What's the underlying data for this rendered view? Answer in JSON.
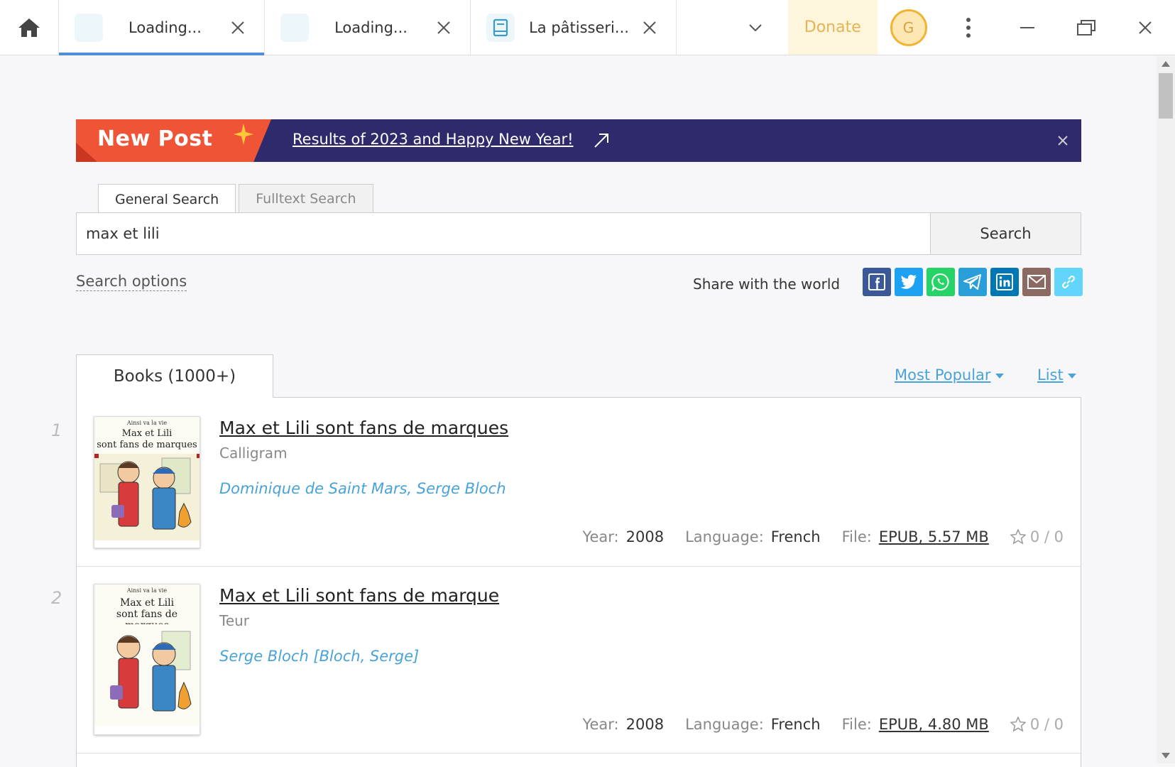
{
  "tabs": [
    {
      "title": "Loading...",
      "active": true
    },
    {
      "title": "Loading...",
      "active": false
    },
    {
      "title": "La pâtisseri...",
      "active": false
    }
  ],
  "toolbar": {
    "donate_label": "Donate",
    "avatar_letter": "G"
  },
  "banner": {
    "badge": "New Post",
    "link_text": "Results of 2023 and Happy New Year!"
  },
  "search": {
    "tabs": [
      "General Search",
      "Fulltext Search"
    ],
    "query": "max et lili",
    "button_label": "Search",
    "options_label": "Search options",
    "share_label": "Share with the world"
  },
  "results": {
    "tab_label": "Books (1000+)",
    "sort_label": "Most Popular",
    "view_label": "List",
    "labels": {
      "year": "Year:",
      "language": "Language:",
      "file": "File:"
    },
    "items": [
      {
        "num": "1",
        "title": "Max et Lili sont fans de marques",
        "publisher": "Calligram",
        "authors": "Dominique de Saint Mars, Serge Bloch",
        "year": "2008",
        "language": "French",
        "file": "EPUB, 5.57 MB",
        "rating": "0 / 0",
        "cover_series": "Ainsi va la vie",
        "cover_title_1": "Max et Lili",
        "cover_title_2": "sont fans de marques"
      },
      {
        "num": "2",
        "title": "Max et Lili sont fans de marque",
        "publisher": "Teur",
        "authors": "Serge Bloch [Bloch, Serge]",
        "year": "2008",
        "language": "French",
        "file": "EPUB, 4.80 MB",
        "rating": "0 / 0",
        "cover_series": "Ainsi va la vie",
        "cover_title_1": "Max et Lili",
        "cover_title_2": "sont fans de marques"
      }
    ]
  },
  "colors": {
    "accent": "#4aa3d8",
    "banner_bg": "#2e2a6c",
    "banner_badge": "#ef5436",
    "donate_bg": "#fdf6dc",
    "donate_text": "#e5b454"
  }
}
